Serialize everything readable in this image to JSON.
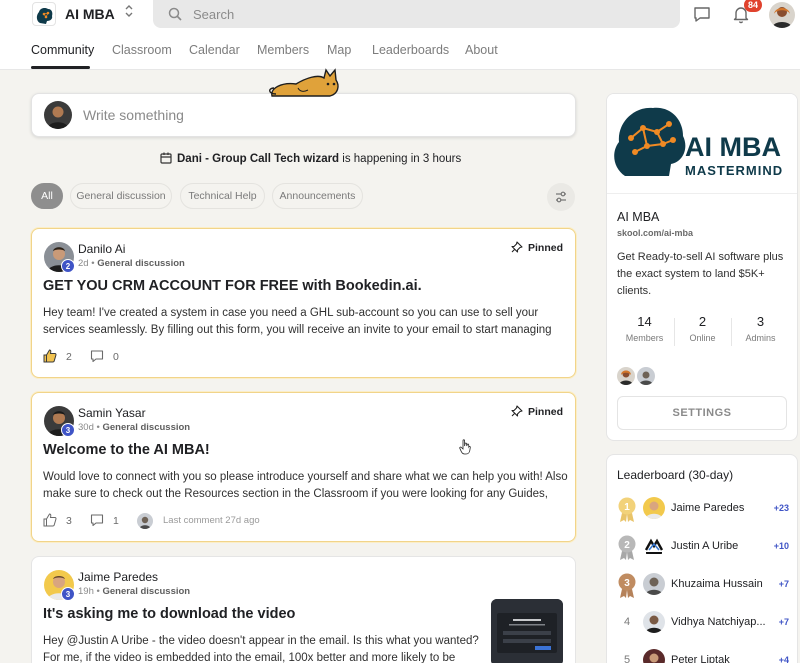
{
  "app": {
    "name": "AI MBA",
    "notification_count": "84"
  },
  "search": {
    "placeholder": "Search"
  },
  "tabs": [
    "Community",
    "Classroom",
    "Calendar",
    "Members",
    "Map",
    "Leaderboards",
    "About"
  ],
  "composer": {
    "placeholder": "Write something"
  },
  "event": {
    "title": "Dani - Group Call Tech wizard",
    "suffix": " is happening in 3 hours"
  },
  "filters": [
    "All",
    "General discussion",
    "Technical Help",
    "Announcements"
  ],
  "pinned_label": "Pinned",
  "posts": [
    {
      "author": "Danilo Ai",
      "level": "2",
      "age": "2d",
      "category": "General discussion",
      "pinned": true,
      "title": "GET YOU CRM ACCOUNT FOR FREE with Bookedin.ai.",
      "body": "Hey team! I've created a system in case you need a GHL sub-account so you can use to sell your services seamlessly. By filling out this form, you will receive an invite to your email to start managing",
      "likes": "2",
      "comments": "0"
    },
    {
      "author": "Samin Yasar",
      "level": "3",
      "age": "30d",
      "category": "General discussion",
      "pinned": true,
      "title": "Welcome to the AI MBA!",
      "body": "Would love to connect with you so please introduce yourself and share what we can help you with! Also make sure to check out the Resources section in the Classroom if you were looking for any Guides,",
      "likes": "3",
      "comments": "1",
      "last_comment": "Last comment 27d ago"
    },
    {
      "author": "Jaime Paredes",
      "level": "3",
      "age": "19h",
      "category": "General discussion",
      "pinned": false,
      "title": "It's asking me to download the video",
      "body": "Hey @Justin A Uribe - the video doesn't appear in the email. Is this what you wanted? For me, if the video is embedded into the email, 100x better and more likely to be"
    }
  ],
  "group": {
    "banner_line1": "AI MBA",
    "banner_line2": "MASTERMIND",
    "name": "AI MBA",
    "url": "skool.com/ai-mba",
    "description": "Get Ready-to-sell AI software plus the exact system to land $5K+ clients.",
    "stats": [
      {
        "value": "14",
        "label": "Members"
      },
      {
        "value": "2",
        "label": "Online"
      },
      {
        "value": "3",
        "label": "Admins"
      }
    ],
    "settings_label": "SETTINGS"
  },
  "leaderboard": {
    "title": "Leaderboard (30-day)",
    "rows": [
      {
        "rank": "1",
        "name": "Jaime Paredes",
        "points": "+23"
      },
      {
        "rank": "2",
        "name": "Justin A Uribe",
        "points": "+10"
      },
      {
        "rank": "3",
        "name": "Khuzaima Hussain",
        "points": "+7"
      },
      {
        "rank": "4",
        "name": "Vidhya Natchiyap...",
        "points": "+7"
      },
      {
        "rank": "5",
        "name": "Peter Liptak",
        "points": "+4"
      }
    ]
  },
  "colors": {
    "accent": "#3f54c6",
    "pinned_border": "#f1d48a",
    "notification": "#e0422d",
    "gold": "#e9c46a",
    "silver": "#a8a8a8",
    "bronze": "#b5825a"
  }
}
